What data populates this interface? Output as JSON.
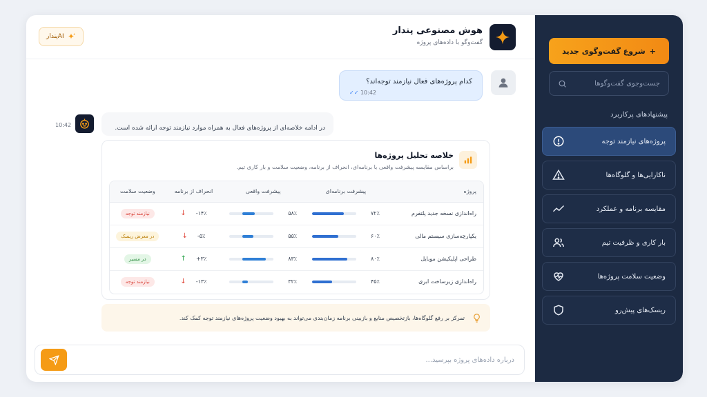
{
  "sidebar": {
    "new_chat_label": "شروع گفت‌وگوی جدید",
    "new_chat_icon": "+",
    "search_placeholder": "جست‌وجوی گفت‌وگوها",
    "section_title": "پیشنهادهای پرکاربرد",
    "items": [
      {
        "label": "پروژه‌های نیازمند توجه",
        "icon": "alert-circle-icon",
        "active": true
      },
      {
        "label": "ناکارایی‌ها و گلوگاه‌ها",
        "icon": "warning-triangle-icon",
        "active": false
      },
      {
        "label": "مقایسه برنامه و عملکرد",
        "icon": "trend-line-icon",
        "active": false
      },
      {
        "label": "بار کاری و ظرفیت تیم",
        "icon": "users-icon",
        "active": false
      },
      {
        "label": "وضعیت سلامت پروژه‌ها",
        "icon": "heart-pulse-icon",
        "active": false
      },
      {
        "label": "ریسک‌های پیش‌رو",
        "icon": "shield-icon",
        "active": false
      }
    ]
  },
  "header": {
    "title": "هوش مصنوعی پندار",
    "subtitle": "گفت‌وگو با داده‌های پروژه",
    "badge_label": "AIپندار"
  },
  "chat": {
    "user_message": "کدام پروژه‌های فعال نیازمند توجه‌اند؟",
    "user_time": "10:42",
    "bot_time": "10:42",
    "bot_message": "در ادامه خلاصه‌ای از پروژه‌های فعال به همراه موارد نیازمند توجه ارائه شده است."
  },
  "analysis": {
    "title": "خلاصه تحلیل پروژه‌ها",
    "subtitle": "براساس مقایسه پیشرفت واقعی با برنامه‌ای، انحراف از برنامه، وضعیت سلامت و بار کاری تیم.",
    "columns": [
      "پروژه",
      "پیشرفت برنامه‌ای",
      "پیشرفت واقعی",
      "انحراف از برنامه",
      "وضعیت سلامت"
    ],
    "rows": [
      {
        "project": "راه‌اندازی نسخه جدید پلتفرم",
        "plan_text": "۷۲٪",
        "plan_value": 72,
        "actual_text": "۵۸٪",
        "actual_value": 58,
        "deviation_text": "-۱۴٪",
        "direction": "down",
        "status": "نیازمند توجه",
        "status_type": "red"
      },
      {
        "project": "یکپارچه‌سازی سیستم مالی",
        "plan_text": "۶۰٪",
        "plan_value": 60,
        "actual_text": "۵۵٪",
        "actual_value": 55,
        "deviation_text": "-۵٪",
        "direction": "down",
        "status": "در معرض ریسک",
        "status_type": "yellow"
      },
      {
        "project": "طراحی اپلیکیشن موبایل",
        "plan_text": "۸۰٪",
        "plan_value": 80,
        "actual_text": "۸۳٪",
        "actual_value": 83,
        "deviation_text": "+۳٪",
        "direction": "up",
        "status": "در مسیر",
        "status_type": "green"
      },
      {
        "project": "راه‌اندازی زیرساخت ابری",
        "plan_text": "۴۵٪",
        "plan_value": 45,
        "actual_text": "۳۲٪",
        "actual_value": 32,
        "deviation_text": "-۱۳٪",
        "direction": "down",
        "status": "نیازمند توجه",
        "status_type": "red"
      }
    ]
  },
  "tip": {
    "text": "تمرکز بر رفع گلوگاه‌ها، بازتخصیص منابع و بازبینی برنامه زمان‌بندی می‌تواند به بهبود وضعیت پروژه‌های نیازمند توجه کمک کند."
  },
  "composer": {
    "placeholder": "درباره داده‌های پروژه بپرسید..."
  },
  "colors": {
    "sidebar_bg": "#1c2a42",
    "accent_orange": "#f59b15",
    "bar_blue": "#2f6fd1"
  }
}
